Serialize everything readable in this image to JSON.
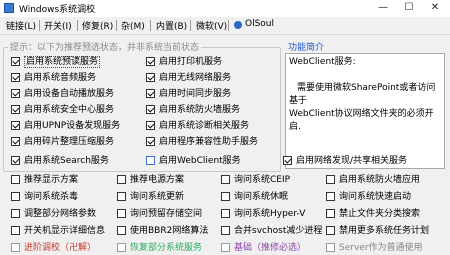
{
  "window": {
    "title": "Windows系统调校",
    "minimize": "—",
    "maximize": "☐",
    "close": "✕"
  },
  "menu": {
    "items": [
      "链接(L)",
      "开关(I)",
      "修复(R)",
      "杂(M)",
      "内置(B)",
      "微软(V)"
    ],
    "brand": "OlSoul"
  },
  "group": {
    "legend": "提示：以下为推荐预选状态，并非系统当前状态"
  },
  "info": {
    "title": "功能简介",
    "line1": "WebClient服务:",
    "line2": "需要使用微软SharePoint或者访问基于",
    "line3": "WebClient协议网络文件夹的必须开启."
  },
  "services_left": [
    {
      "label": "启用系统预读服务",
      "checked": true,
      "highlight": true
    },
    {
      "label": "启用系统音频服务",
      "checked": true
    },
    {
      "label": "启用设备自动播放服务",
      "checked": true
    },
    {
      "label": "启用系统安全中心服务",
      "checked": true
    },
    {
      "label": "启用UPNP设备发现服务",
      "checked": true
    },
    {
      "label": "启用碎片整理压缩服务",
      "checked": true
    },
    {
      "label": "启用系统Search服务",
      "checked": true
    }
  ],
  "services_mid": [
    {
      "label": "启用打印机服务",
      "checked": true
    },
    {
      "label": "启用无线网络服务",
      "checked": true
    },
    {
      "label": "启用时间同步服务",
      "checked": true
    },
    {
      "label": "启用系统防火墙服务",
      "checked": true
    },
    {
      "label": "启用系统诊断相关服务",
      "checked": true
    },
    {
      "label": "启用程序兼容性助手服务",
      "checked": true
    },
    {
      "label": "启用WebClient服务",
      "checked": false
    }
  ],
  "network": {
    "label": "启用网络发现/共享相关服务",
    "checked": true
  },
  "options_rows": [
    [
      "推荐显示方案",
      "推荐电源方案",
      "询问系统CEIP",
      "启用系统防火墙应用"
    ],
    [
      "询问系统杀毒",
      "询问系统更新",
      "询问系统休眠",
      "询问系统快速启动"
    ],
    [
      "调整部分网络参数",
      "询问预留存储空间",
      "询问系统Hyper-V",
      "禁止文件夹分类搜索"
    ],
    [
      "开关机显示详细信息",
      "使用BBR2网络算法",
      "合并svchost减少进程",
      "禁用更多系统任务计划"
    ]
  ],
  "bottom": [
    "进阶调校（卍解）",
    "恢复部分系统服务",
    "基础（推修必选）",
    "Server作为普通使用"
  ]
}
